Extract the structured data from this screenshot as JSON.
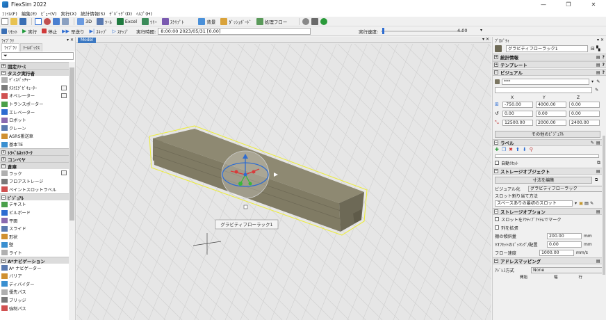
{
  "window": {
    "title": "FlexSim 2022",
    "controls": [
      "—",
      "❐",
      "✕"
    ]
  },
  "menu": {
    "items": [
      "ﾌｧｲﾙ(F)",
      "編集(E)",
      "ﾋﾞｭｰ(V)",
      "実行(X)",
      "統計情報(S)",
      "ﾃﾞﾊﾞｯｸﾞ(D)",
      "ﾍﾙﾌﾟ(H)"
    ]
  },
  "toolbar1": {
    "btn_3d": "3D",
    "btn_tool": "ﾂｰﾙ",
    "btn_excel": "Excel",
    "btn_tree": "ﾂﾘｰ",
    "btn_script": "ｽｸﾘﾌﾟﾄ",
    "btn_background": "背景",
    "btn_dashboard": "ﾀﾞｯｼｭﾎﾞｰﾄﾞ",
    "btn_process_flow": "処理フロー"
  },
  "toolbar2": {
    "reset": "ﾘｾｯﾄ",
    "run": "実行",
    "stop": "停止",
    "fast_forward": "早送り",
    "skip": "ｽｷｯﾌﾟ",
    "step": "ｽﾃｯﾌﾟ",
    "run_time_label": "実行時間:",
    "run_time_value": "8:00:00  2023/05/31  [0.00]",
    "run_speed_label": "実行速度:",
    "run_speed_value": "4.00",
    "run_speed_fraction": 0.02
  },
  "library": {
    "title": "ﾗｲﾌﾞﾗﾘ",
    "tab_library": "ﾗｲﾌﾞﾗﾘ",
    "tab_toolbox": "ﾂｰﾙﾎﾞｯｸｽ",
    "sections": [
      {
        "name": "固定ﾘｿｰｽ",
        "items": []
      },
      {
        "name": "タスク実行者",
        "items": [
          "ﾃﾞｨｽﾊﾟｯﾁｬｰ",
          "ﾀｽｸｴｸﾞｾﾞｷｭｰﾀｰ",
          "オペレーター",
          "トランスポーター",
          "エレベーター",
          "ロボット",
          "クレーン",
          "ASRS搬送車",
          "基本TE"
        ]
      },
      {
        "name": "ﾄﾗﾍﾞﾙﾈｯﾄﾜｰｸ",
        "items": []
      },
      {
        "name": "コンベヤ",
        "items": []
      },
      {
        "name": "倉庫",
        "items": [
          "ラック",
          "フロアストレージ",
          "ペイントスロットラベル"
        ]
      },
      {
        "name": "ﾋﾞｼﾞｭｱﾙ",
        "items": [
          "テキスト",
          "ビルボード",
          "平面",
          "スライド",
          "形状",
          "壁",
          "ライト"
        ]
      },
      {
        "name": "A*ナビゲーション",
        "items": [
          "A* ナビゲーター",
          "バリア",
          "ディバイダー",
          "優先パス",
          "ブリッジ",
          "強制パス"
        ]
      }
    ]
  },
  "viewport": {
    "tab_label": "Model",
    "object_label": "グラビティフローラック1"
  },
  "properties": {
    "title": "ﾌﾟﾛﾊﾟﾃｨ",
    "object_name": "グラビティフローラック1",
    "sections": {
      "statistics": "統計情報",
      "template": "テンプレート",
      "visual": "ビジュアル",
      "labels": "ラベル",
      "storage_object": "ストレージオブジェクト",
      "storage_options": "ストレージオプション",
      "address_mapping": "アドレスマッピング"
    },
    "visual": {
      "shape_value": "***",
      "col_x": "X",
      "col_y": "Y",
      "col_z": "Z",
      "position": [
        "-750.00",
        "4000.00",
        "0.00"
      ],
      "rotation": [
        "0.00",
        "0.00",
        "0.00"
      ],
      "size": [
        "12500.00",
        "2000.00",
        "2400.00"
      ],
      "other_visual_button": "その他のﾋﾞｼﾞｭｱﾙ"
    },
    "labels": {
      "auto_reset": "自動ﾘｾｯﾄ"
    },
    "storage_object": {
      "dimension_edit_button": "寸法を編集",
      "visualization_label": "ビジュアル化",
      "visualization_value": "グラビティフローラック",
      "slot_assign_label": "スロット割り当て方法",
      "slot_assign_value": "スペースありの最初のスロット"
    },
    "storage_options": {
      "mark_slots_label": "スロットをｱｸﾃｨﾌﾞｱｲﾃﾑでマーク",
      "extend_columns_label": "列を拡張",
      "shelf_tilt_label": "棚の傾斜量",
      "shelf_tilt_value": "200.00",
      "shelf_tilt_unit": "mm",
      "y_offset_label": "Yｵﾌｾｯﾄのﾋﾟｯｷﾝｸﾞ/配置",
      "y_offset_value": "0.00",
      "y_offset_unit": "mm",
      "flow_speed_label": "フロー速度",
      "flow_speed_value": "1000.00",
      "flow_speed_unit": "mm/s"
    },
    "address_mapping": {
      "scheme_label": "ｱﾄﾞﾚｽ方式",
      "scheme_value": "None",
      "col_start": "開始",
      "col_width": "幅",
      "col_row": "行"
    }
  },
  "colors": {
    "accent": "#2d6cd1",
    "rack_face": "#8b8670",
    "rack_side": "#6f6b58",
    "selection": "#e8e84a"
  }
}
